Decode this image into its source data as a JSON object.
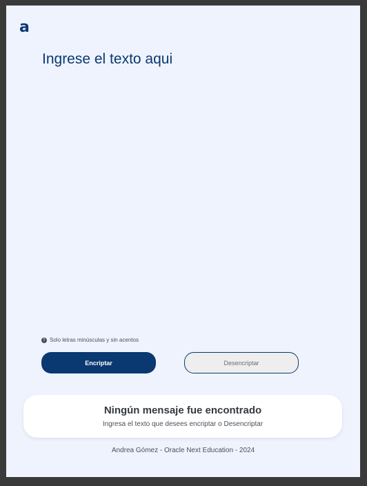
{
  "app": {
    "logo_text": "a",
    "accent_color": "#0a3871",
    "background_color": "#eff3fd"
  },
  "input": {
    "placeholder": "Ingrese el texto aqui",
    "value": ""
  },
  "hint": {
    "icon": "info-icon",
    "text": "Solo letras minúsculas y sin acentos"
  },
  "buttons": {
    "encrypt_label": "Encriptar",
    "decrypt_label": "Desencriptar"
  },
  "output": {
    "title": "Ningún mensaje fue encontrado",
    "subtitle": "Ingresa el texto que desees encriptar o Desencriptar"
  },
  "footer": {
    "text": "Andrea Gómez - Oracle Next Education - 2024"
  }
}
